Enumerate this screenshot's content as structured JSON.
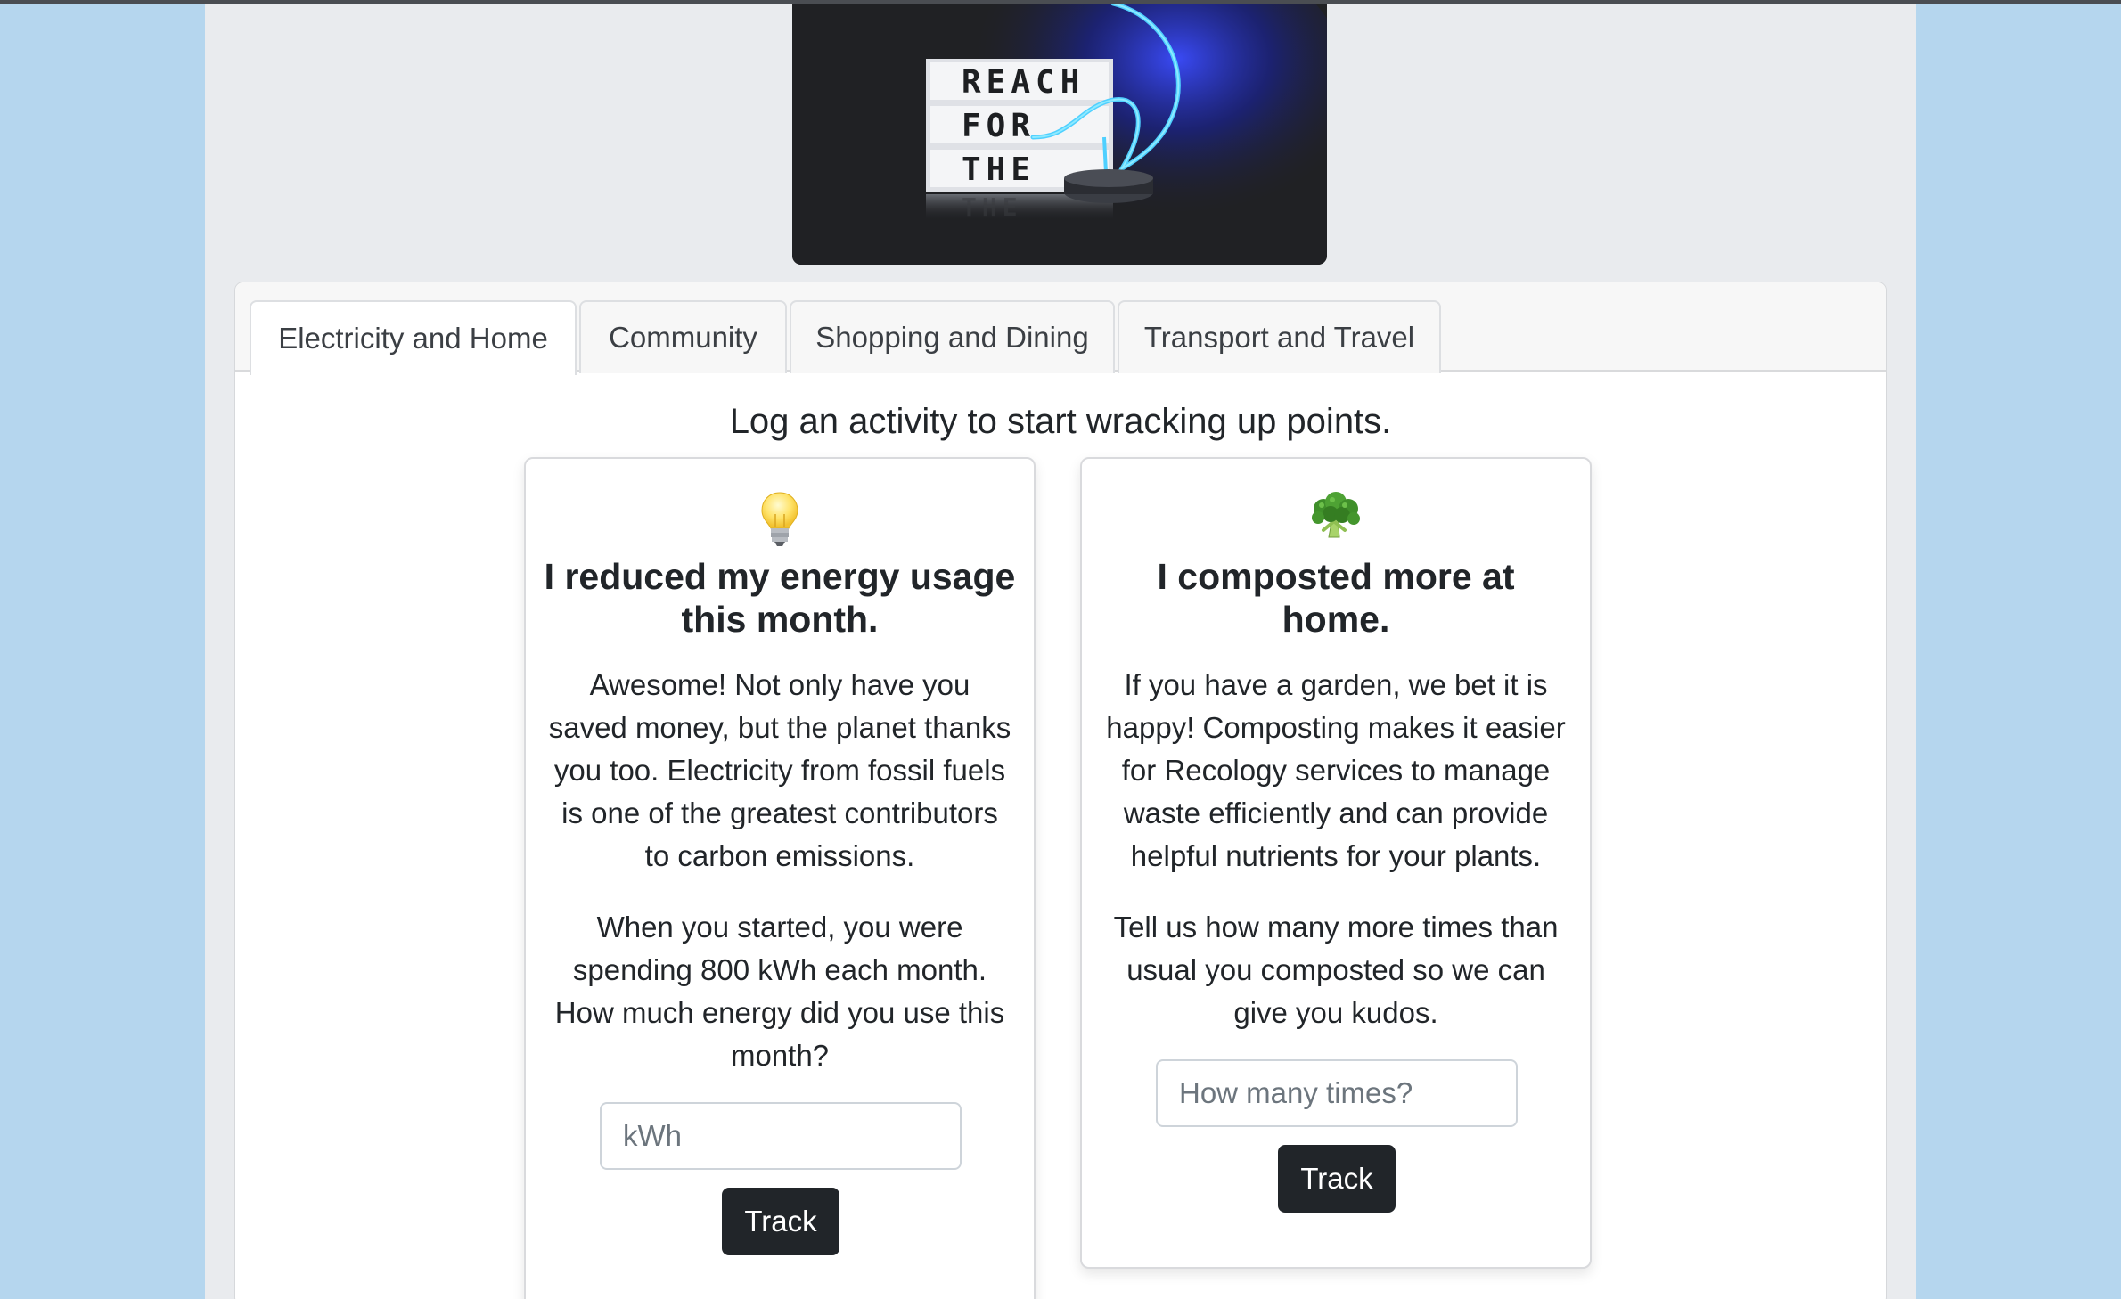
{
  "hero": {
    "image_label": "reach-for-the-moon-lightbox",
    "sign_lines": [
      "REACH",
      "FOR",
      "THE"
    ],
    "reflection_text": "THE"
  },
  "tabs": [
    {
      "label": "Electricity and Home",
      "active": true
    },
    {
      "label": "Community",
      "active": false
    },
    {
      "label": "Shopping and Dining",
      "active": false
    },
    {
      "label": "Transport and Travel",
      "active": false
    }
  ],
  "prompt": "Log an activity to start wracking up points.",
  "cards": [
    {
      "icon": "light-bulb-icon",
      "title": "I reduced my energy usage this month.",
      "text1": "Awesome! Not only have you saved money, but the planet thanks you too. Electricity from fossil fuels is one of the greatest contributors to carbon emissions.",
      "text2": "When you started, you were spending 800 kWh each month. How much energy did you use this month?",
      "input_placeholder": "kWh",
      "input_value": "",
      "button_label": "Track"
    },
    {
      "icon": "broccoli-icon",
      "title": "I composted more at home.",
      "text1": "If you have a garden, we bet it is happy! Composting makes it easier for Recology services to manage waste efficiently and can provide helpful nutrients for your plants.",
      "text2": "Tell us how many more times than usual you composted so we can give you kudos.",
      "input_placeholder": "How many times?",
      "input_value": "",
      "button_label": "Track"
    }
  ],
  "colors": {
    "page_background": "#b5d6ee",
    "content_background": "#e9ebee",
    "button_background": "#212529",
    "neon_blue": "#4fd0ff"
  }
}
